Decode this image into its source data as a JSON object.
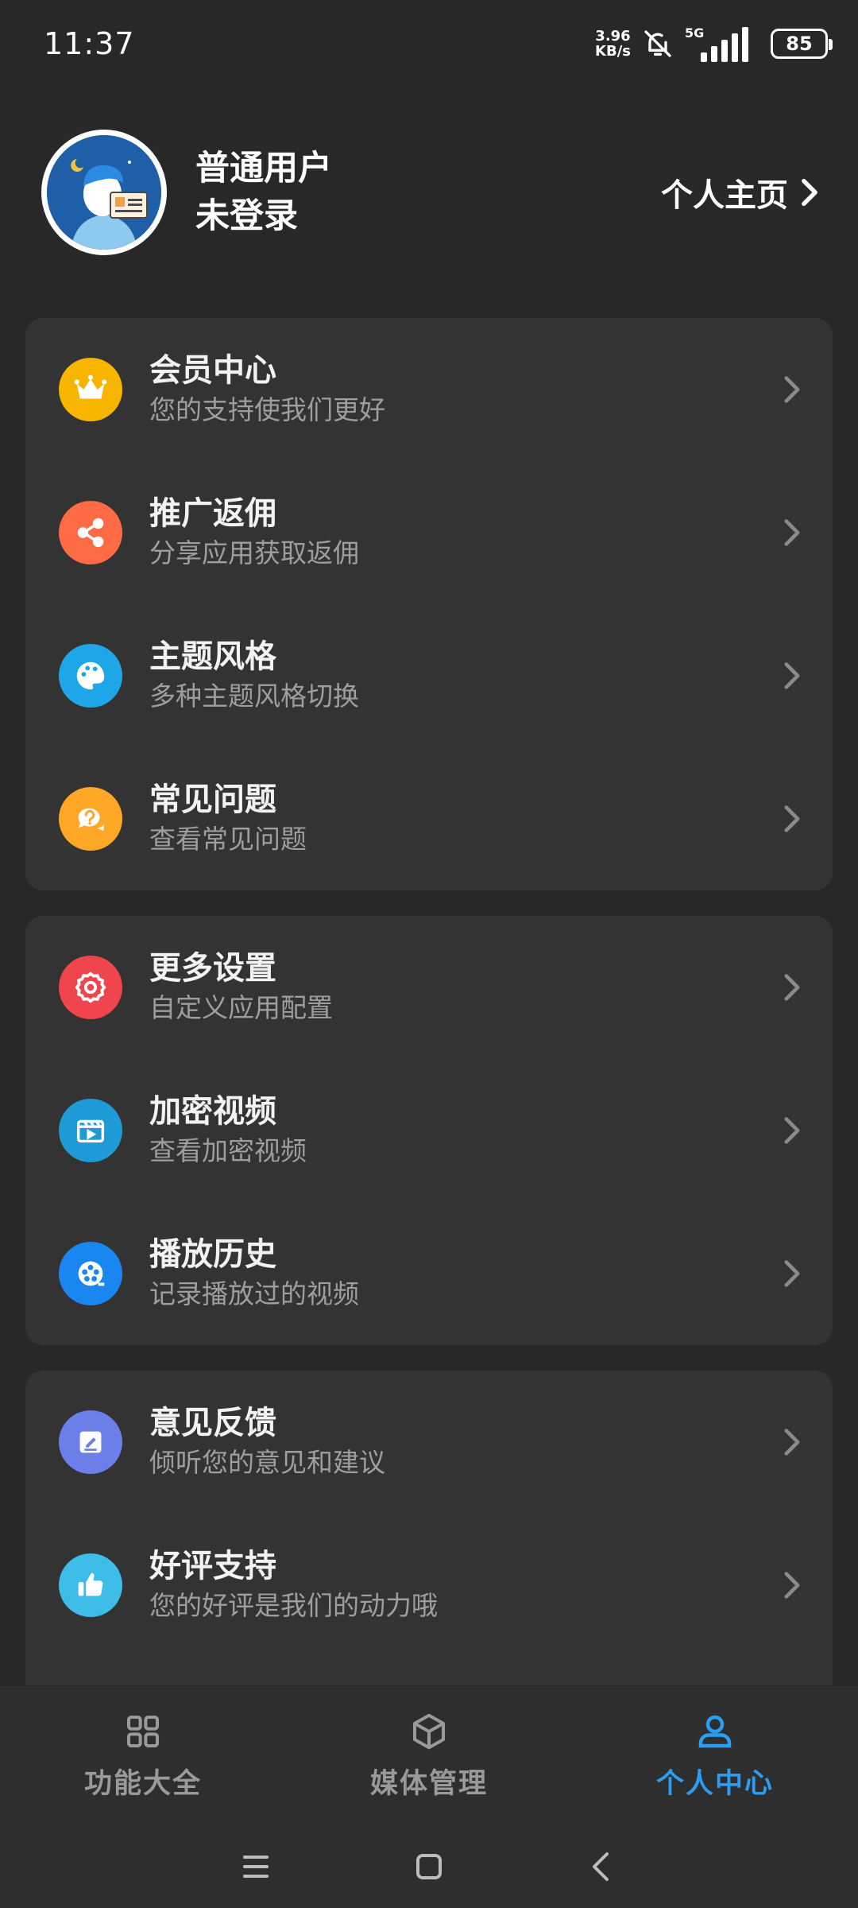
{
  "status_bar": {
    "time": "11:37",
    "net_speed_value": "3.96",
    "net_speed_unit": "KB/s",
    "network_type": "5G",
    "battery": "85"
  },
  "profile": {
    "name": "普通用户",
    "status": "未登录",
    "homepage_link": "个人主页"
  },
  "groups": [
    {
      "items": [
        {
          "title": "会员中心",
          "subtitle": "您的支持使我们更好",
          "icon": "crown-icon",
          "color": "#f7b500"
        },
        {
          "title": "推广返佣",
          "subtitle": "分享应用获取返佣",
          "icon": "share-icon",
          "color": "#ff6b45"
        },
        {
          "title": "主题风格",
          "subtitle": "多种主题风格切换",
          "icon": "palette-icon",
          "color": "#1ea7e8"
        },
        {
          "title": "常见问题",
          "subtitle": "查看常见问题",
          "icon": "question-chat-icon",
          "color": "#ffa726"
        }
      ]
    },
    {
      "items": [
        {
          "title": "更多设置",
          "subtitle": "自定义应用配置",
          "icon": "gear-icon",
          "color": "#f0454d"
        },
        {
          "title": "加密视频",
          "subtitle": "查看加密视频",
          "icon": "video-clapper-icon",
          "color": "#1e9ad6"
        },
        {
          "title": "播放历史",
          "subtitle": "记录播放过的视频",
          "icon": "film-reel-icon",
          "color": "#1a87f0"
        }
      ]
    },
    {
      "items": [
        {
          "title": "意见反馈",
          "subtitle": "倾听您的意见和建议",
          "icon": "edit-note-icon",
          "color": "#6c7fe8"
        },
        {
          "title": "好评支持",
          "subtitle": "您的好评是我们的动力哦",
          "icon": "thumbs-up-icon",
          "color": "#3dbde8"
        }
      ]
    }
  ],
  "bottom_nav": {
    "tabs": [
      {
        "label": "功能大全",
        "icon": "grid-icon",
        "active": false
      },
      {
        "label": "媒体管理",
        "icon": "cube-icon",
        "active": false
      },
      {
        "label": "个人中心",
        "icon": "person-icon",
        "active": true
      }
    ]
  },
  "system_nav": {
    "icons": [
      "menu-icon",
      "home-square-icon",
      "back-icon"
    ]
  },
  "colors": {
    "background": "#282828",
    "card": "#333333",
    "accent": "#2a9df4"
  }
}
